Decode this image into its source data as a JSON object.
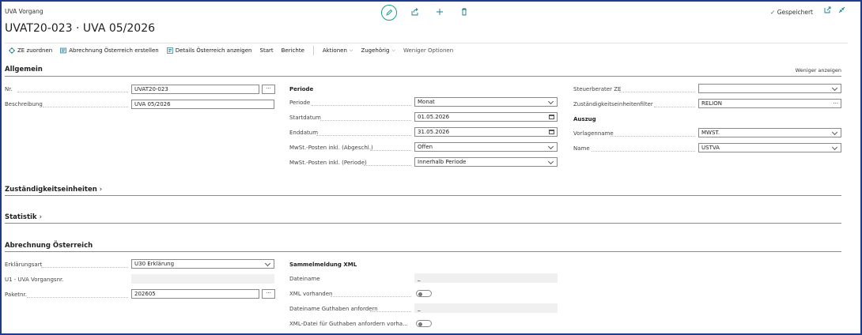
{
  "header": {
    "breadcrumb": "UVA Vorgang",
    "title": "UVAT20-023 · UVA 05/2026",
    "saved": "Gespeichert",
    "icons": [
      "edit-icon",
      "share-icon",
      "add-icon",
      "delete-icon",
      "open-new-window-icon",
      "collapse-icon"
    ]
  },
  "actions": {
    "assign_ze": "ZE zuordnen",
    "calc_at": "Abrechnung Österreich erstellen",
    "details_at": "Details Österreich anzeigen",
    "start": "Start",
    "reports": "Berichte",
    "actions_menu": "Aktionen",
    "related_menu": "Zugehörig",
    "fewer": "Weniger Optionen"
  },
  "general": {
    "title": "Allgemein",
    "show_less": "Weniger anzeigen",
    "nr_label": "Nr.",
    "nr_value": "UVAT20-023",
    "desc_label": "Beschreibung",
    "desc_value": "UVA 05/2026",
    "period_head": "Periode",
    "period_label": "Periode",
    "period_value": "Monat",
    "start_label": "Startdatum",
    "start_value": "01.05.2026",
    "end_label": "Enddatum",
    "end_value": "31.05.2026",
    "vat_closed_label": "MwSt.-Posten inkl. (Abgeschl.)",
    "vat_closed_value": "Offen",
    "vat_period_label": "MwSt.-Posten inkl. (Periode)",
    "vat_period_value": "Innerhalb Periode",
    "advisor_label": "Steuerberater ZE",
    "advisor_value": "",
    "filter_label": "Zuständigkeitseinheitenfilter",
    "filter_value": "RELION",
    "extract_head": "Auszug",
    "template_label": "Vorlagenname",
    "template_value": "MWST.",
    "name_label": "Name",
    "name_value": "USTVA"
  },
  "responsibility": {
    "title": "Zuständigkeitseinheiten"
  },
  "stats": {
    "title": "Statistik"
  },
  "austria": {
    "title": "Abrechnung Österreich",
    "decl_label": "Erklärungsart",
    "decl_value": "U30 Erklärung",
    "u1_label": "U1 - UVA Vorgangsnr.",
    "u1_value": "",
    "pkg_label": "Paketnr.",
    "pkg_value": "202605",
    "xml_head": "Sammelmeldung XML",
    "file_label": "Dateiname",
    "file_value": "_",
    "xml_exists_label": "XML vorhanden",
    "credit_file_label": "Dateiname Guthaben anfordern",
    "credit_file_value": "_",
    "xml_credit_label": "XML-Datei für Guthaben anfordern vorha..."
  }
}
